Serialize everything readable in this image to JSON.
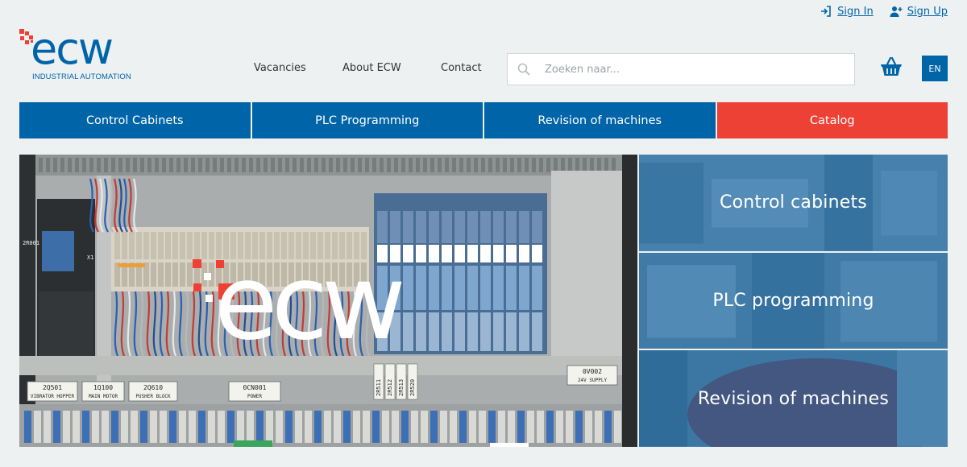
{
  "account": {
    "sign_in": "Sign In",
    "sign_up": "Sign Up"
  },
  "logo": {
    "word": "ecw",
    "subtitle": "INDUSTRIAL AUTOMATION"
  },
  "nav": {
    "vacancies": "Vacancies",
    "about": "About ECW",
    "contact": "Contact"
  },
  "search": {
    "placeholder": "Zoeken naar..."
  },
  "language": "EN",
  "categories": [
    {
      "label": "Control Cabinets"
    },
    {
      "label": "PLC Programming"
    },
    {
      "label": "Revision of machines"
    },
    {
      "label": "Catalog"
    }
  ],
  "hero": {
    "logo_word": "ecw",
    "labels": [
      "2Q501",
      "VIBRATOR HOPPER",
      "1Q100",
      "MAIN MOTOR",
      "2Q610",
      "PUSHER BLOCK",
      "0CN001",
      "POWER",
      "0V002",
      "24V SUPPLY",
      "2R511",
      "2R512",
      "2R513",
      "2R520",
      "X1",
      "2R001"
    ]
  },
  "tiles": [
    {
      "label": "Control cabinets"
    },
    {
      "label": "PLC programming"
    },
    {
      "label": "Revision of machines"
    }
  ],
  "colors": {
    "brand_blue": "#0064a8",
    "brand_red": "#ee4136",
    "background": "#edf1f2"
  },
  "icons": {
    "sign_in": "sign-in-icon",
    "sign_up": "user-plus-icon",
    "search": "search-icon",
    "basket": "basket-icon"
  }
}
